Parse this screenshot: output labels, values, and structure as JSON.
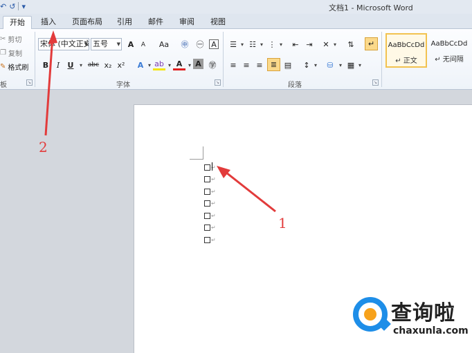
{
  "window": {
    "title": "文档1 - Microsoft Word"
  },
  "quick_access": {
    "undo_icon": "↶",
    "redo_icon": "↺",
    "customize_icon": "▾"
  },
  "tabs": [
    {
      "label": "开始",
      "active": true
    },
    {
      "label": "插入",
      "active": false
    },
    {
      "label": "页面布局",
      "active": false
    },
    {
      "label": "引用",
      "active": false
    },
    {
      "label": "邮件",
      "active": false
    },
    {
      "label": "审阅",
      "active": false
    },
    {
      "label": "视图",
      "active": false
    }
  ],
  "clipboard": {
    "cut": "剪切",
    "copy": "复制",
    "format_painter": "格式刷",
    "group_label": "板"
  },
  "font": {
    "name": "宋体 (中文正文)",
    "size": "五号",
    "grow": "A",
    "shrink": "A",
    "case": "Aa",
    "group_label": "字体",
    "bold": "B",
    "italic": "I",
    "underline": "U",
    "strike": "abc",
    "subscript": "x₂",
    "superscript": "x²"
  },
  "paragraph": {
    "group_label": "段落",
    "show_marks": "↵"
  },
  "styles": [
    {
      "sample": "AaBbCcDd",
      "name": "正文",
      "selected": true
    },
    {
      "sample": "AaBbCcDd",
      "name": "无间隔",
      "selected": false
    }
  ],
  "document": {
    "checkboxes": 7,
    "paragraph_mark": "↵"
  },
  "annotations": {
    "label_1": "1",
    "label_2": "2"
  },
  "watermark": {
    "name": "查询啦",
    "url": "chaxunla.com"
  },
  "colors": {
    "accent_red": "#e23b3b",
    "highlight": "#fbd98a",
    "brand_blue": "#1e8ee8",
    "brand_orange": "#f7a21b"
  }
}
